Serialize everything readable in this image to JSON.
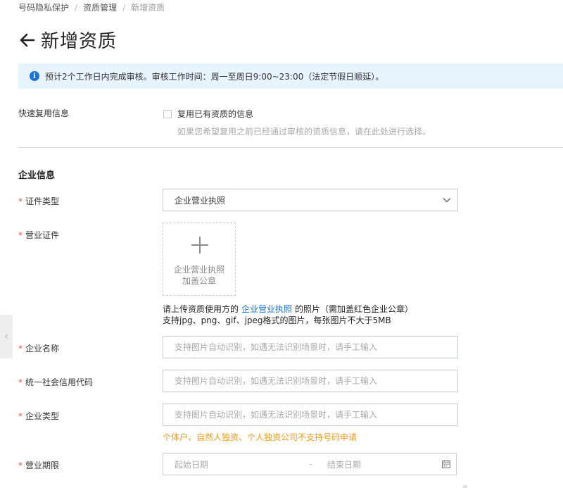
{
  "breadcrumb": {
    "items": [
      "号码隐私保护",
      "资质管理",
      "新增资质"
    ],
    "separator": "/"
  },
  "header": {
    "title": "新增资质",
    "back_icon": "arrow-left-icon"
  },
  "notice": {
    "icon": "info-icon",
    "icon_glyph": "i",
    "text": "预计2个工作日内完成审核。审核工作时间：周一至周日9:00~23:00（法定节假日顺延）。",
    "background_color": "#e7f3fd",
    "icon_color": "#1a74d6"
  },
  "reuse": {
    "label": "快速复用信息",
    "checkbox_label": "复用已有资质的信息",
    "checked": false,
    "hint": "如果您希望复用之前已经通过审核的资质信息，请在此处进行选择。"
  },
  "section": {
    "title": "企业信息"
  },
  "required_mark": "*",
  "fields": {
    "cert_type": {
      "label": "证件类型",
      "value": "企业营业执照",
      "icon": "chevron-down-icon"
    },
    "license": {
      "label": "营业证件",
      "upload_caption_line1": "企业营业执照",
      "upload_caption_line2": "加盖公章",
      "desc_prefix": "请上传资质使用方的",
      "desc_link": "企业营业执照",
      "desc_suffix": "的照片（需加盖红色企业公章）",
      "desc_line2": "支持jpg、png、gif、jpeg格式的图片，每张图片不大于5MB"
    },
    "company_name": {
      "label": "企业名称",
      "placeholder": "支持图片自动识别，如遇无法识别场景时，请手工输入"
    },
    "credit_code": {
      "label": "统一社会信用代码",
      "placeholder": "支持图片自动识别，如遇无法识别场景时，请手工输入"
    },
    "company_type": {
      "label": "企业类型",
      "placeholder": "支持图片自动识别，如遇无法识别场景时，请手工输入",
      "warning": "个体户、自然人独资、个人独资公司不支持号码申请",
      "warning_color": "#ef9a1a"
    },
    "business_term": {
      "label": "营业期限",
      "start_placeholder": "起始日期",
      "separator": "-",
      "end_placeholder": "结束日期",
      "icon": "calendar-icon"
    }
  },
  "side_tab": {
    "glyph": "‹",
    "icon": "collapse-left-icon"
  },
  "colors": {
    "required": "#e2544a",
    "link": "#1a74d6",
    "border": "#c8cbd0"
  }
}
